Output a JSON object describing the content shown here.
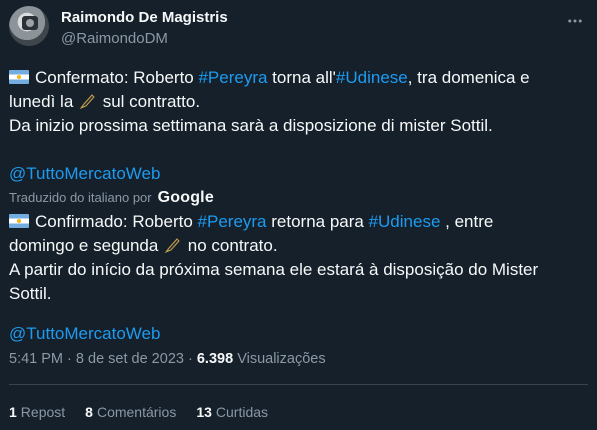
{
  "author": {
    "display_name": "Raimondo De Magistris",
    "handle": "@RaimondoDM"
  },
  "icons": {
    "more": "more-horizontal-icon",
    "flag": "argentina-flag-icon",
    "pen": "fountain-pen-icon"
  },
  "original": {
    "line1_prefix": "Confermato: Roberto ",
    "hashtag1": "#Pereyra",
    "line1_mid": " torna all'",
    "hashtag2": "#Udinese",
    "line1_suffix": ", tra domenica e",
    "line2_prefix": "lunedì la ",
    "line2_suffix": " sul contratto.",
    "line3": "Da inizio prossima settimana sarà a disposizione di mister Sottil.",
    "mention": "@TuttoMercatoWeb"
  },
  "translation_label": {
    "text": "Traduzido do italiano por",
    "provider": "Google"
  },
  "translated": {
    "line1_prefix": "Confirmado: Roberto ",
    "hashtag1": "#Pereyra",
    "line1_mid": " retorna para ",
    "hashtag2": "#Udinese",
    "line1_suffix": " , entre",
    "line2_prefix": "domingo e segunda ",
    "line2_suffix": " no contrato.",
    "line3": "A partir do início da próxima semana ele estará à disposição do Mister",
    "line4": "Sottil.",
    "mention": "@TuttoMercatoWeb"
  },
  "meta": {
    "time": "5:41 PM",
    "separator": "·",
    "date": "8 de set de 2023",
    "views_count": "6.398",
    "views_label": "Visualizações"
  },
  "stats": [
    {
      "count": "1",
      "label": "Repost"
    },
    {
      "count": "8",
      "label": "Comentários"
    },
    {
      "count": "13",
      "label": "Curtidas"
    }
  ]
}
